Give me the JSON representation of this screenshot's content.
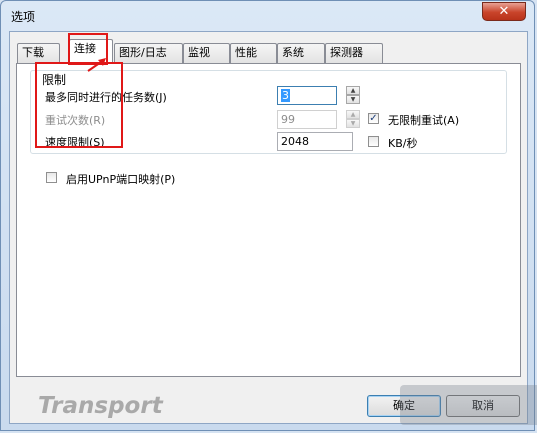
{
  "window": {
    "title": "选项",
    "close_glyph": "✕"
  },
  "tabs": [
    {
      "label": "下载",
      "active": false
    },
    {
      "label": "连接",
      "active": true
    },
    {
      "label": "图形/日志",
      "active": false
    },
    {
      "label": "监视",
      "active": false
    },
    {
      "label": "性能",
      "active": false
    },
    {
      "label": "系统",
      "active": false
    },
    {
      "label": "探测器",
      "active": false
    }
  ],
  "limits": {
    "title": "限制",
    "max_tasks_label": "最多同时进行的任务数(J)",
    "max_tasks_value": "3",
    "retry_label": "重试次数(R)",
    "retry_value": "99",
    "speed_label": "速度限制(S)",
    "speed_value": "2048",
    "unlimited_retry_label": "无限制重试(A)",
    "unlimited_retry_checked": true,
    "kbps_label": "KB/秒",
    "kbps_checked": false
  },
  "upnp": {
    "label": "启用UPnP端口映射(P)",
    "checked": false
  },
  "footer": {
    "watermark": "Transport",
    "ok_label": "确定",
    "cancel_label": "取消"
  },
  "icons": {
    "check": "✓",
    "spin_up": "▲",
    "spin_down": "▼"
  },
  "colors": {
    "highlight_red": "#e01818",
    "selection_blue": "#3399ff"
  }
}
